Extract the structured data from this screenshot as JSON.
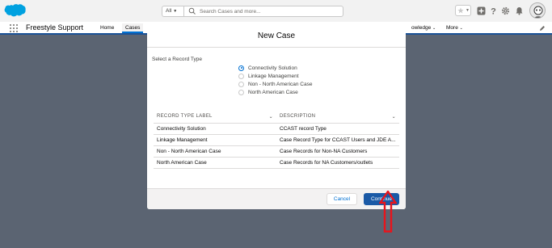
{
  "header": {
    "search_scope": "All",
    "search_placeholder": "Search Cases and more..."
  },
  "nav": {
    "app_name": "Freestyle Support",
    "items": [
      {
        "label": "Home"
      },
      {
        "label": "Cases"
      },
      {
        "label": "owledge"
      },
      {
        "label": "More"
      }
    ]
  },
  "modal": {
    "title": "New Case",
    "record_type_label": "Select a Record Type",
    "options": [
      {
        "label": "Connectivity Solution",
        "selected": true
      },
      {
        "label": "Linkage Management",
        "selected": false
      },
      {
        "label": "Non - North American Case",
        "selected": false
      },
      {
        "label": "North American Case",
        "selected": false
      }
    ],
    "table": {
      "columns": [
        "RECORD TYPE LABEL",
        "DESCRIPTION"
      ],
      "rows": [
        [
          "Connectivity Solution",
          "CCAST record Type"
        ],
        [
          "Linkage Management",
          "Case Record Type for CCAST Users and JDE A..."
        ],
        [
          "Non - North American Case",
          "Case Records for Non-NA Customers"
        ],
        [
          "North American Case",
          "Case Records for NA Customers/outlets"
        ]
      ]
    },
    "cancel_label": "Cancel",
    "continue_label": "Continue"
  },
  "colors": {
    "brand_blue": "#1a5aa6",
    "overlay": "#5b6472",
    "annotation_red": "#e8141c"
  }
}
